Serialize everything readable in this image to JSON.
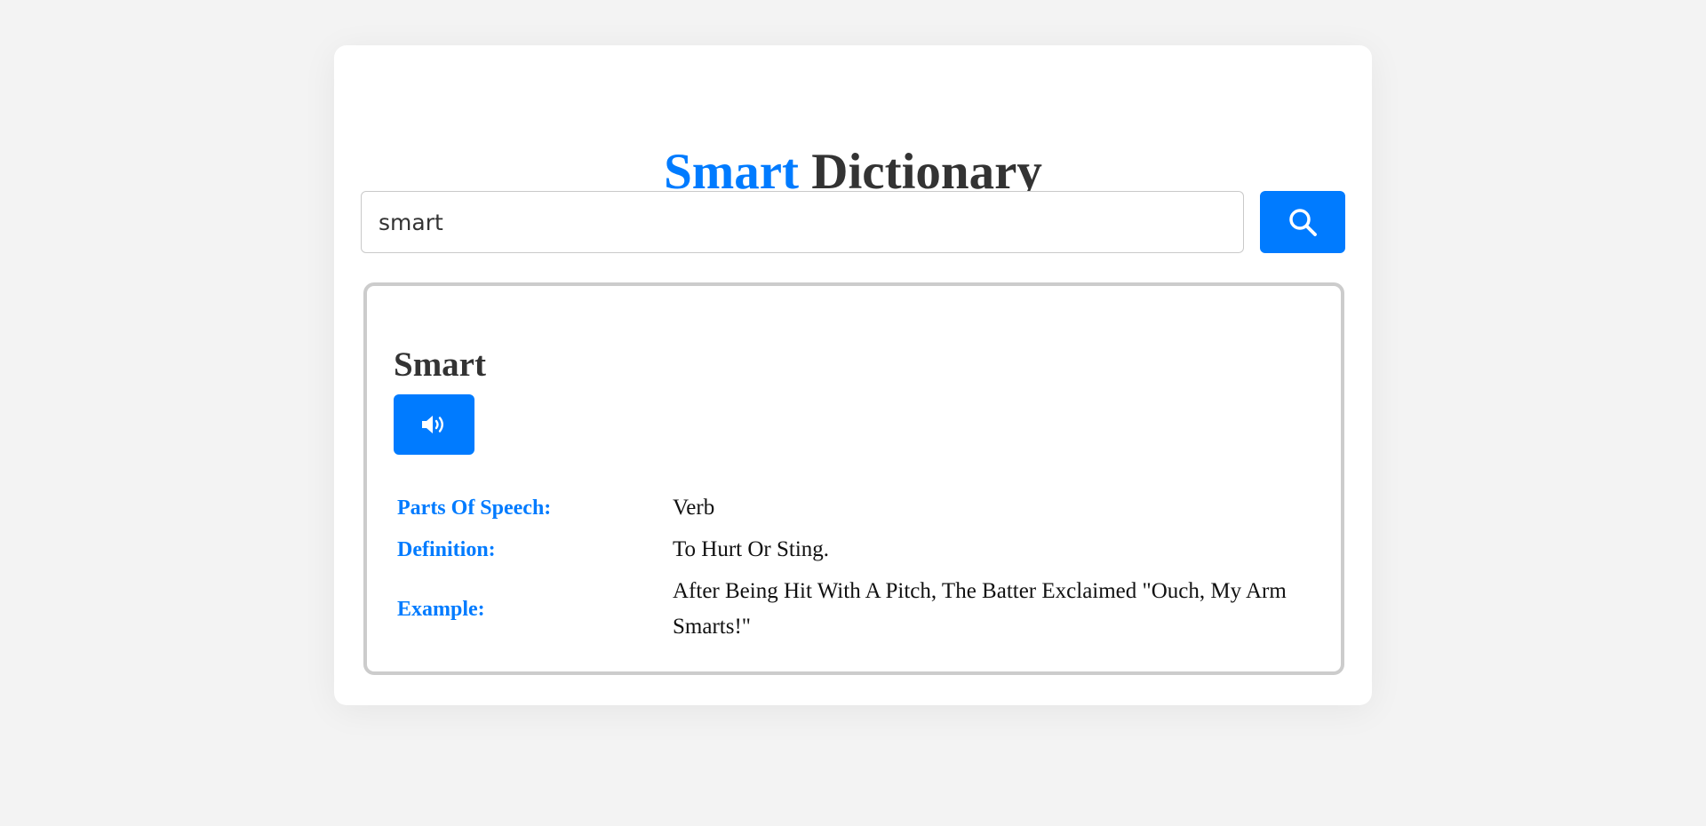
{
  "header": {
    "title_accent": "Smart",
    "title_rest": "Dictionary"
  },
  "search": {
    "value": "smart",
    "button_icon": "search-icon"
  },
  "result": {
    "word": "Smart",
    "audio_icon": "volume-icon",
    "details": [
      {
        "label": "Parts Of Speech:",
        "value": "Verb"
      },
      {
        "label": "Definition:",
        "value": "To Hurt Or Sting."
      },
      {
        "label": "Example:",
        "value": "After Being Hit With A Pitch, The Batter Exclaimed \"Ouch, My Arm Smarts!\""
      }
    ]
  },
  "colors": {
    "accent": "#007bff",
    "text": "#333333",
    "background": "#f3f3f3"
  }
}
